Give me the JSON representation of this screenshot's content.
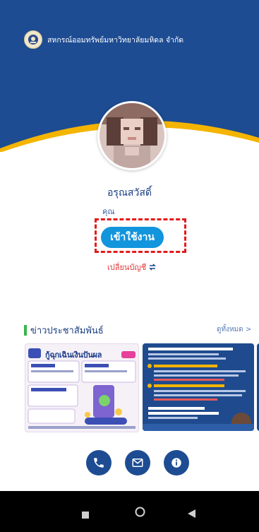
{
  "header": {
    "org_name": "สหกรณ์ออมทรัพย์มหาวิทยาลัยมหิดล จำกัด",
    "bg_color": "#1d4c93",
    "accent_color": "#f4b400"
  },
  "profile": {
    "greeting": "อรุณสวัสดิ์",
    "user_prefix": "คุณ",
    "login_label": "เข้าใช้งาน",
    "switch_account_label": "เปลี่ยนบัญชี",
    "switch_icon": "swap-icon"
  },
  "news": {
    "section_title": "ข่าวประชาสัมพันธ์",
    "see_all_label": "ดูทั้งหมด >",
    "cards": [
      {
        "headline": "กู้ฉุกเฉินเงินปันผล"
      },
      {
        "headline": ""
      }
    ]
  },
  "contact": {
    "buttons": [
      {
        "icon": "phone-icon"
      },
      {
        "icon": "mail-icon"
      },
      {
        "icon": "info-icon"
      }
    ]
  },
  "system_nav": {
    "buttons": [
      {
        "icon": "recents-icon"
      },
      {
        "icon": "home-icon"
      },
      {
        "icon": "back-icon"
      }
    ]
  }
}
